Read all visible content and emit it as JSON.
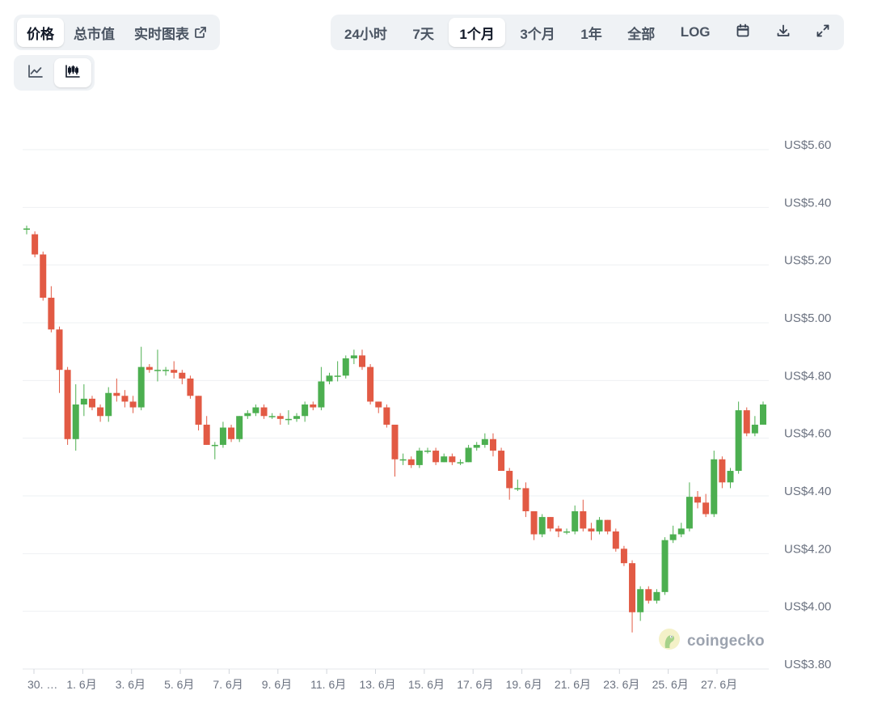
{
  "tabs_left": [
    {
      "label": "价格",
      "active": true
    },
    {
      "label": "总市值",
      "active": false
    },
    {
      "label": "实时图表",
      "active": false,
      "external": true
    }
  ],
  "tabs_right": [
    {
      "label": "24小时",
      "active": false
    },
    {
      "label": "7天",
      "active": false
    },
    {
      "label": "1个月",
      "active": true
    },
    {
      "label": "3个月",
      "active": false
    },
    {
      "label": "1年",
      "active": false
    },
    {
      "label": "全部",
      "active": false
    },
    {
      "label": "LOG",
      "active": false
    }
  ],
  "icons": {
    "calendar": "calendar-icon",
    "download": "download-icon",
    "fullscreen": "fullscreen-icon",
    "external": "external-link-icon",
    "line_chart": "line-chart-icon",
    "candlestick_chart": "candlestick-chart-icon"
  },
  "view_toggle": {
    "active": "candlestick"
  },
  "watermark": {
    "text": "coingecko"
  },
  "colors": {
    "up": "#4caf50",
    "down": "#e25a44",
    "grid": "#eef0f3",
    "axis_text": "#6b7280"
  },
  "chart_data": {
    "type": "candlestick",
    "y_tick_labels": [
      "US$3.80",
      "US$4.00",
      "US$4.20",
      "US$4.40",
      "US$4.60",
      "US$4.80",
      "US$5.00",
      "US$5.20",
      "US$5.40",
      "US$5.60"
    ],
    "y_ticks": [
      3.8,
      4.0,
      4.2,
      4.4,
      4.6,
      4.8,
      5.0,
      5.2,
      5.4,
      5.6
    ],
    "ylim": [
      3.8,
      5.6
    ],
    "x_tick_labels": [
      "30. …",
      "1. 6月",
      "3. 6月",
      "5. 6月",
      "7. 6月",
      "9. 6月",
      "11. 6月",
      "13. 6月",
      "15. 6月",
      "17. 6月",
      "19. 6月",
      "21. 6月",
      "23. 6月",
      "25. 6月",
      "27. 6月"
    ],
    "grid": true,
    "candles": [
      [
        5.31,
        5.31,
        5.32,
        5.29
      ],
      [
        5.29,
        5.22,
        5.3,
        5.21
      ],
      [
        5.22,
        5.07,
        5.23,
        5.06
      ],
      [
        5.07,
        4.96,
        5.11,
        4.95
      ],
      [
        4.96,
        4.82,
        4.97,
        4.74
      ],
      [
        4.82,
        4.58,
        4.83,
        4.56
      ],
      [
        4.58,
        4.7,
        4.77,
        4.54
      ],
      [
        4.7,
        4.72,
        4.77,
        4.66
      ],
      [
        4.72,
        4.69,
        4.73,
        4.68
      ],
      [
        4.69,
        4.66,
        4.7,
        4.64
      ],
      [
        4.66,
        4.74,
        4.76,
        4.64
      ],
      [
        4.74,
        4.73,
        4.79,
        4.71
      ],
      [
        4.73,
        4.71,
        4.75,
        4.69
      ],
      [
        4.71,
        4.69,
        4.73,
        4.67
      ],
      [
        4.69,
        4.83,
        4.9,
        4.68
      ],
      [
        4.83,
        4.82,
        4.84,
        4.81
      ],
      [
        4.82,
        4.82,
        4.89,
        4.78
      ],
      [
        4.82,
        4.82,
        4.83,
        4.8
      ],
      [
        4.82,
        4.81,
        4.85,
        4.79
      ],
      [
        4.81,
        4.79,
        4.82,
        4.77
      ],
      [
        4.79,
        4.73,
        4.8,
        4.72
      ],
      [
        4.73,
        4.63,
        4.73,
        4.61
      ],
      [
        4.63,
        4.56,
        4.66,
        4.56
      ],
      [
        4.56,
        4.56,
        4.57,
        4.51
      ],
      [
        4.56,
        4.62,
        4.64,
        4.55
      ],
      [
        4.62,
        4.58,
        4.63,
        4.57
      ],
      [
        4.58,
        4.66,
        4.66,
        4.57
      ],
      [
        4.66,
        4.67,
        4.68,
        4.65
      ],
      [
        4.67,
        4.69,
        4.7,
        4.66
      ],
      [
        4.69,
        4.66,
        4.7,
        4.65
      ],
      [
        4.66,
        4.66,
        4.67,
        4.65
      ],
      [
        4.66,
        4.65,
        4.67,
        4.63
      ],
      [
        4.65,
        4.65,
        4.68,
        4.63
      ],
      [
        4.65,
        4.66,
        4.67,
        4.64
      ],
      [
        4.66,
        4.7,
        4.71,
        4.64
      ],
      [
        4.7,
        4.69,
        4.71,
        4.68
      ],
      [
        4.69,
        4.78,
        4.83,
        4.68
      ],
      [
        4.78,
        4.8,
        4.81,
        4.77
      ],
      [
        4.8,
        4.8,
        4.85,
        4.78
      ],
      [
        4.8,
        4.86,
        4.87,
        4.79
      ],
      [
        4.86,
        4.87,
        4.89,
        4.84
      ],
      [
        4.87,
        4.83,
        4.89,
        4.82
      ],
      [
        4.83,
        4.71,
        4.84,
        4.7
      ],
      [
        4.71,
        4.69,
        4.71,
        4.67
      ],
      [
        4.69,
        4.63,
        4.7,
        4.62
      ],
      [
        4.63,
        4.51,
        4.63,
        4.45
      ],
      [
        4.51,
        4.51,
        4.53,
        4.49
      ],
      [
        4.51,
        4.49,
        4.52,
        4.48
      ],
      [
        4.49,
        4.54,
        4.55,
        4.48
      ],
      [
        4.54,
        4.54,
        4.55,
        4.53
      ],
      [
        4.54,
        4.5,
        4.55,
        4.49
      ],
      [
        4.5,
        4.52,
        4.53,
        4.5
      ],
      [
        4.52,
        4.5,
        4.53,
        4.49
      ],
      [
        4.5,
        4.5,
        4.51,
        4.49
      ],
      [
        4.5,
        4.55,
        4.56,
        4.5
      ],
      [
        4.55,
        4.56,
        4.57,
        4.54
      ],
      [
        4.56,
        4.58,
        4.6,
        4.55
      ],
      [
        4.58,
        4.54,
        4.6,
        4.52
      ],
      [
        4.54,
        4.47,
        4.55,
        4.47
      ],
      [
        4.47,
        4.41,
        4.48,
        4.37
      ],
      [
        4.41,
        4.41,
        4.44,
        4.4
      ],
      [
        4.41,
        4.33,
        4.43,
        4.31
      ],
      [
        4.33,
        4.25,
        4.33,
        4.23
      ],
      [
        4.25,
        4.31,
        4.32,
        4.24
      ],
      [
        4.31,
        4.27,
        4.31,
        4.26
      ],
      [
        4.27,
        4.26,
        4.28,
        4.24
      ],
      [
        4.26,
        4.26,
        4.27,
        4.25
      ],
      [
        4.26,
        4.33,
        4.35,
        4.25
      ],
      [
        4.33,
        4.27,
        4.37,
        4.26
      ],
      [
        4.27,
        4.26,
        4.29,
        4.23
      ],
      [
        4.26,
        4.3,
        4.31,
        4.25
      ],
      [
        4.3,
        4.26,
        4.3,
        4.25
      ],
      [
        4.26,
        4.2,
        4.27,
        4.19
      ],
      [
        4.2,
        4.15,
        4.21,
        4.14
      ],
      [
        4.15,
        3.98,
        4.16,
        3.91
      ],
      [
        3.98,
        4.06,
        4.07,
        3.95
      ],
      [
        4.06,
        4.02,
        4.07,
        4.01
      ],
      [
        4.02,
        4.05,
        4.06,
        4.01
      ],
      [
        4.05,
        4.23,
        4.24,
        4.04
      ],
      [
        4.23,
        4.25,
        4.28,
        4.22
      ],
      [
        4.25,
        4.27,
        4.29,
        4.24
      ],
      [
        4.27,
        4.38,
        4.43,
        4.26
      ],
      [
        4.38,
        4.36,
        4.4,
        4.34
      ],
      [
        4.36,
        4.32,
        4.39,
        4.31
      ],
      [
        4.32,
        4.51,
        4.54,
        4.31
      ],
      [
        4.51,
        4.43,
        4.52,
        4.41
      ],
      [
        4.43,
        4.47,
        4.48,
        4.41
      ],
      [
        4.47,
        4.68,
        4.71,
        4.46
      ],
      [
        4.68,
        4.6,
        4.69,
        4.59
      ],
      [
        4.6,
        4.63,
        4.66,
        4.59
      ],
      [
        4.63,
        4.7,
        4.71,
        4.63
      ]
    ]
  }
}
